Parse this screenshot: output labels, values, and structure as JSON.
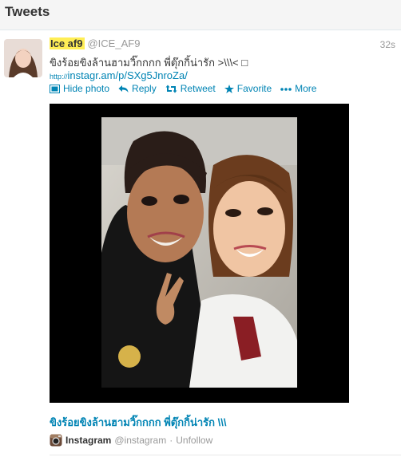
{
  "header": {
    "title": "Tweets"
  },
  "tweet": {
    "name": "Ice af9",
    "handle": "@ICE_AF9",
    "time": "32s",
    "text": "ขิงร้อยขิงล้านฮามวิ๊กกกก พี่ตุ๊กกิ้น่ารัก >\\\\\\< □",
    "link_proto": "http://",
    "link": "instagr.am/p/SXg5JnroZa/",
    "actions": {
      "hide_photo": "Hide photo",
      "reply": "Reply",
      "retweet": "Retweet",
      "favorite": "Favorite",
      "more": "More"
    },
    "caption": "ขิงร้อยขิงล้านฮามวิ๊กกกก พี่ตุ๊กกิ้น่ารัก \\\\\\",
    "source": {
      "app": "Instagram",
      "handle": "@instagram",
      "separator": "·",
      "unfollow": "Unfollow"
    }
  },
  "colors": {
    "link": "#0084b4",
    "highlight": "#ffee55",
    "muted": "#999999"
  }
}
